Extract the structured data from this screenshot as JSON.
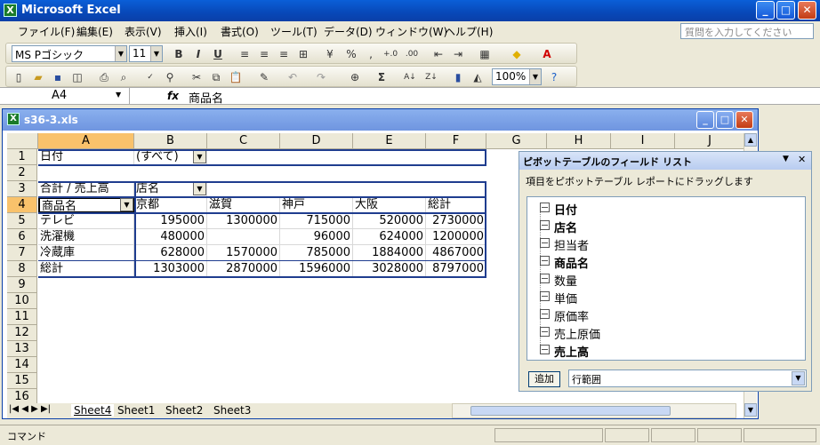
{
  "app": {
    "title": "Microsoft Excel"
  },
  "menu": [
    "ファイル(F)",
    "編集(E)",
    "表示(V)",
    "挿入(I)",
    "書式(O)",
    "ツール(T)",
    "データ(D)",
    "ウィンドウ(W)",
    "ヘルプ(H)"
  ],
  "help_placeholder": "質問を入力してください",
  "format_toolbar": {
    "font": "MS Pゴシック",
    "size": "11"
  },
  "standard_toolbar": {
    "zoom": "100%"
  },
  "formula_bar": {
    "name_box": "A4",
    "fx": "fx",
    "value": "商品名"
  },
  "workbook": {
    "title": "s36-3.xls"
  },
  "columns": [
    "A",
    "B",
    "C",
    "D",
    "E",
    "F",
    "G",
    "H",
    "I",
    "J"
  ],
  "rows": [
    "1",
    "2",
    "3",
    "4",
    "5",
    "6",
    "7",
    "8",
    "9",
    "10",
    "11",
    "12",
    "13",
    "14",
    "15",
    "16"
  ],
  "cells": {
    "A1": "日付",
    "B1": "(すべて)",
    "A3": "合計 / 売上高",
    "B3": "店名",
    "A4": "商品名",
    "B4": "京都",
    "C4": "滋賀",
    "D4": "神戸",
    "E4": "大阪",
    "F4": "総計",
    "A5": "テレビ",
    "B5": "195000",
    "C5": "1300000",
    "D5": "715000",
    "E5": "520000",
    "F5": "2730000",
    "A6": "洗濯機",
    "B6": "480000",
    "C6": "",
    "D6": "96000",
    "E6": "624000",
    "F6": "1200000",
    "A7": "冷蔵庫",
    "B7": "628000",
    "C7": "1570000",
    "D7": "785000",
    "E7": "1884000",
    "F7": "4867000",
    "A8": "総計",
    "B8": "1303000",
    "C8": "2870000",
    "D8": "1596000",
    "E8": "3028000",
    "F8": "8797000"
  },
  "sheet_tabs": [
    "Sheet4",
    "Sheet1",
    "Sheet2",
    "Sheet3"
  ],
  "active_sheet": "Sheet4",
  "pivot_field_list": {
    "title": "ピボットテーブルのフィールド リスト",
    "description": "項目をピボットテーブル レポートにドラッグします",
    "fields": [
      {
        "label": "日付",
        "used": true
      },
      {
        "label": "店名",
        "used": true
      },
      {
        "label": "担当者",
        "used": false
      },
      {
        "label": "商品名",
        "used": true
      },
      {
        "label": "数量",
        "used": false
      },
      {
        "label": "単価",
        "used": false
      },
      {
        "label": "原価率",
        "used": false
      },
      {
        "label": "売上原価",
        "used": false
      },
      {
        "label": "売上高",
        "used": true
      }
    ],
    "add_button": "追加",
    "area": "行範囲"
  },
  "status": {
    "text": "コマンド"
  },
  "colors": {
    "selected_header": "#f9c26b",
    "pivot_border": "#1f3d8f",
    "title_bar": "#0a5fd8"
  }
}
